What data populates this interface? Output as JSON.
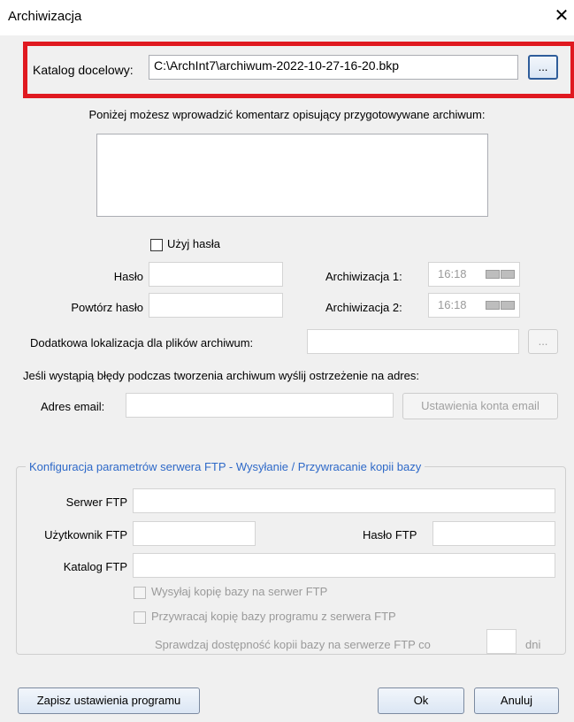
{
  "window": {
    "title": "Archiwizacja",
    "close_glyph": "✕"
  },
  "target": {
    "label": "Katalog docelowy:",
    "value": "C:\\ArchInt7\\archiwum-2022-10-27-16-20.bkp",
    "browse_label": "..."
  },
  "comment": {
    "instruction": "Poniżej możesz wprowadzić komentarz opisujący przygotowywane archiwum:",
    "value": ""
  },
  "password": {
    "use_label": "Użyj hasła",
    "use_checked": false,
    "password_label": "Hasło",
    "repeat_label": "Powtórz hasło"
  },
  "schedule": {
    "archive1_label": "Archiwizacja 1:",
    "archive1_time": "16:18",
    "archive2_label": "Archiwizacja 2:",
    "archive2_time": "16:18"
  },
  "extra_location": {
    "label": "Dodatkowa lokalizacja dla plików archiwum:",
    "browse_label": "..."
  },
  "email": {
    "notice": "Jeśli wystąpią błędy podczas tworzenia archiwum wyślij ostrzeżenie na adres:",
    "label": "Adres email:",
    "settings_button": "Ustawienia konta email"
  },
  "ftp": {
    "legend": "Konfiguracja parametrów serwera FTP - Wysyłanie / Przywracanie kopii bazy",
    "server_label": "Serwer FTP",
    "user_label": "Użytkownik FTP",
    "password_label": "Hasło FTP",
    "dir_label": "Katalog FTP",
    "send_copy_label": "Wysyłaj kopię bazy na serwer FTP",
    "restore_copy_label": "Przywracaj kopię bazy programu z serwera FTP",
    "check_label": "Sprawdzaj dostępność kopii bazy na serwerze FTP co",
    "days_label": "dni"
  },
  "footer": {
    "save_settings": "Zapisz ustawienia programu",
    "ok": "Ok",
    "cancel": "Anuluj"
  }
}
